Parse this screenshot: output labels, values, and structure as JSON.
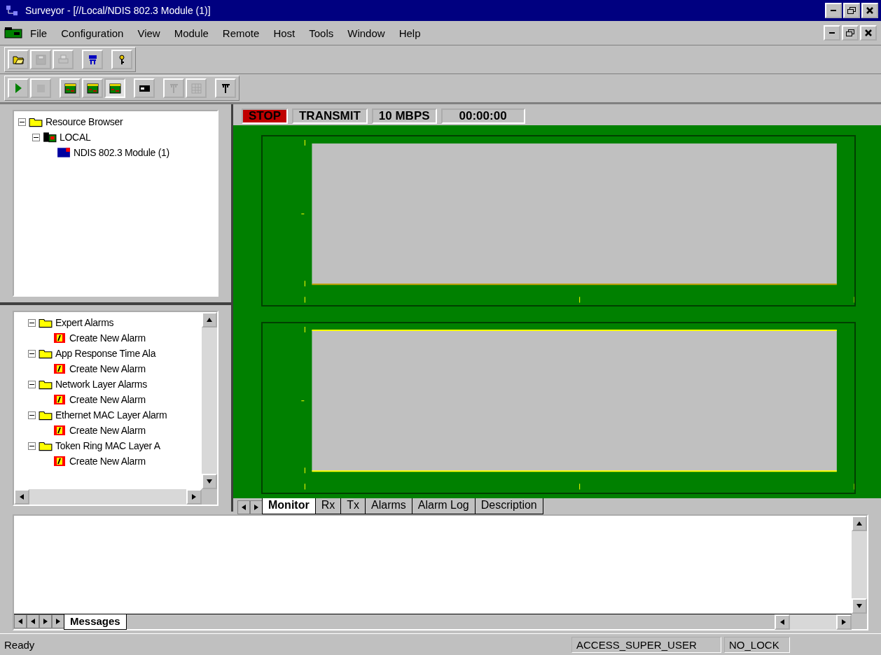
{
  "window": {
    "title": "Surveyor - [//Local/NDIS 802.3 Module (1)]"
  },
  "menu": [
    "File",
    "Configuration",
    "View",
    "Module",
    "Remote",
    "Host",
    "Tools",
    "Window",
    "Help"
  ],
  "toolbars": [
    {
      "buttons": [
        {
          "disabled": false,
          "pressed": false
        },
        {
          "disabled": true,
          "pressed": false
        },
        {
          "disabled": true,
          "pressed": false
        },
        {
          "disabled": false,
          "pressed": false
        },
        {
          "disabled": false,
          "pressed": false
        }
      ]
    },
    {
      "buttons": [
        {
          "disabled": false,
          "pressed": false
        },
        {
          "disabled": true,
          "pressed": false
        },
        {
          "disabled": false,
          "pressed": false
        },
        {
          "disabled": false,
          "pressed": false
        },
        {
          "disabled": false,
          "pressed": true
        },
        {
          "disabled": false,
          "pressed": false
        },
        {
          "disabled": true,
          "pressed": false
        },
        {
          "disabled": true,
          "pressed": false
        },
        {
          "disabled": false,
          "pressed": false
        }
      ]
    }
  ],
  "resource_tree": [
    {
      "label": "Resource Browser",
      "kind": "folder",
      "expanded": true,
      "children": [
        {
          "label": "LOCAL",
          "kind": "host",
          "expanded": true,
          "children": [
            {
              "label": "NDIS 802.3 Module (1)",
              "kind": "module"
            }
          ]
        }
      ]
    }
  ],
  "alarm_tree": [
    {
      "label": "Expert Alarms",
      "kind": "folder",
      "expanded": true,
      "children": [
        {
          "label": "Create New Alarm",
          "kind": "alarm"
        }
      ]
    },
    {
      "label": "App Response Time Ala",
      "kind": "folder",
      "expanded": true,
      "children": [
        {
          "label": "Create New Alarm",
          "kind": "alarm"
        }
      ]
    },
    {
      "label": "Network Layer Alarms",
      "kind": "folder",
      "expanded": true,
      "children": [
        {
          "label": "Create New Alarm",
          "kind": "alarm"
        }
      ]
    },
    {
      "label": "Ethernet MAC Layer Alarm",
      "kind": "folder",
      "expanded": true,
      "children": [
        {
          "label": "Create New Alarm",
          "kind": "alarm"
        }
      ]
    },
    {
      "label": "Token Ring MAC Layer A",
      "kind": "folder",
      "expanded": true,
      "children": [
        {
          "label": "Create New Alarm",
          "kind": "alarm"
        }
      ]
    }
  ],
  "status_strip": [
    {
      "text": "STOP",
      "kind": "alert"
    },
    {
      "text": "TRANSMIT",
      "kind": "plain"
    },
    {
      "text": "10 MBPS",
      "kind": "plain"
    },
    {
      "text": "00:00:00",
      "kind": "plain"
    }
  ],
  "view_tabs": [
    {
      "label": "Monitor",
      "selected": true
    },
    {
      "label": "Rx",
      "selected": false
    },
    {
      "label": "Tx",
      "selected": false
    },
    {
      "label": "Alarms",
      "selected": false
    },
    {
      "label": "Alarm Log",
      "selected": false
    },
    {
      "label": "Description",
      "selected": false
    }
  ],
  "message_tabs": [
    {
      "label": "Messages",
      "selected": true
    }
  ],
  "status_bar": {
    "message": "Ready",
    "panels": [
      "ACCESS_SUPER_USER",
      "NO_LOCK"
    ]
  }
}
